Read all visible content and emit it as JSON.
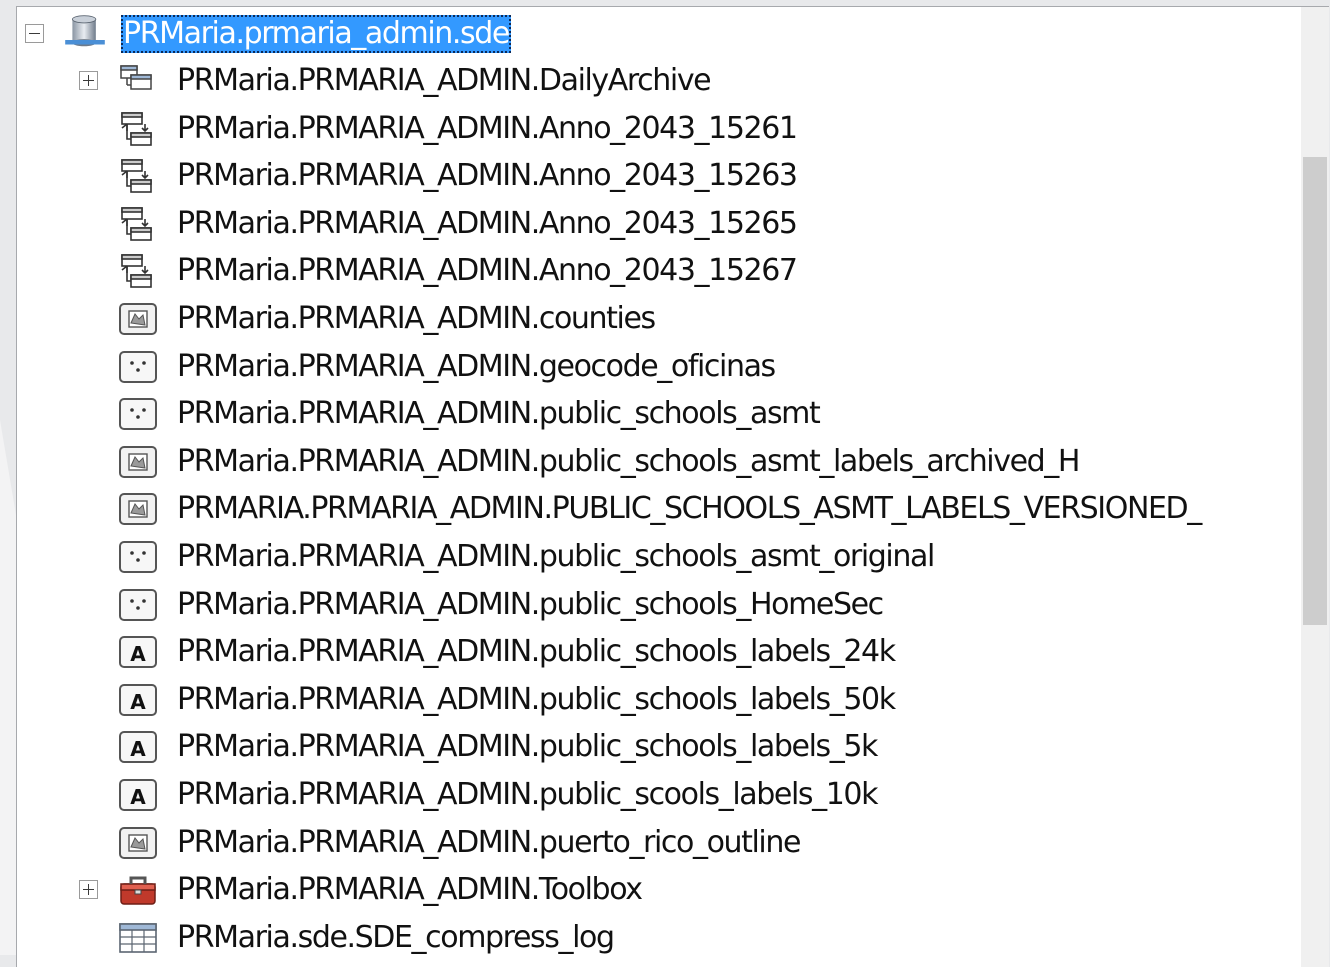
{
  "colors": {
    "selection": "#3399ff",
    "background": "#ffffff",
    "text": "#111111"
  },
  "tree": {
    "root": {
      "label": "PRMaria.prmaria_admin.sde",
      "icon": "database-connection-icon",
      "expanded": true,
      "selected": true
    },
    "items": [
      {
        "label": "PRMaria.PRMARIA_ADMIN.DailyArchive",
        "icon": "feature-dataset-icon",
        "expandable": true
      },
      {
        "label": "PRMaria.PRMARIA_ADMIN.Anno_2043_15261",
        "icon": "relationship-class-icon",
        "expandable": false
      },
      {
        "label": "PRMaria.PRMARIA_ADMIN.Anno_2043_15263",
        "icon": "relationship-class-icon",
        "expandable": false
      },
      {
        "label": "PRMaria.PRMARIA_ADMIN.Anno_2043_15265",
        "icon": "relationship-class-icon",
        "expandable": false
      },
      {
        "label": "PRMaria.PRMARIA_ADMIN.Anno_2043_15267",
        "icon": "relationship-class-icon",
        "expandable": false
      },
      {
        "label": "PRMaria.PRMARIA_ADMIN.counties",
        "icon": "polygon-feature-class-icon",
        "expandable": false
      },
      {
        "label": "PRMaria.PRMARIA_ADMIN.geocode_oficinas",
        "icon": "point-feature-class-icon",
        "expandable": false
      },
      {
        "label": "PRMaria.PRMARIA_ADMIN.public_schools_asmt",
        "icon": "point-feature-class-icon",
        "expandable": false
      },
      {
        "label": "PRMaria.PRMARIA_ADMIN.public_schools_asmt_labels_archived_H",
        "icon": "polygon-feature-class-icon",
        "expandable": false
      },
      {
        "label": "PRMARIA.PRMARIA_ADMIN.PUBLIC_SCHOOLS_ASMT_LABELS_VERSIONED_",
        "icon": "polygon-feature-class-icon",
        "expandable": false
      },
      {
        "label": "PRMaria.PRMARIA_ADMIN.public_schools_asmt_original",
        "icon": "point-feature-class-icon",
        "expandable": false
      },
      {
        "label": "PRMaria.PRMARIA_ADMIN.public_schools_HomeSec",
        "icon": "point-feature-class-icon",
        "expandable": false
      },
      {
        "label": "PRMaria.PRMARIA_ADMIN.public_schools_labels_24k",
        "icon": "annotation-feature-class-icon",
        "expandable": false
      },
      {
        "label": "PRMaria.PRMARIA_ADMIN.public_schools_labels_50k",
        "icon": "annotation-feature-class-icon",
        "expandable": false
      },
      {
        "label": "PRMaria.PRMARIA_ADMIN.public_schools_labels_5k",
        "icon": "annotation-feature-class-icon",
        "expandable": false
      },
      {
        "label": "PRMaria.PRMARIA_ADMIN.public_scools_labels_10k",
        "icon": "annotation-feature-class-icon",
        "expandable": false
      },
      {
        "label": "PRMaria.PRMARIA_ADMIN.puerto_rico_outline",
        "icon": "polygon-feature-class-icon",
        "expandable": false
      },
      {
        "label": "PRMaria.PRMARIA_ADMIN.Toolbox",
        "icon": "toolbox-icon",
        "expandable": true
      },
      {
        "label": "PRMaria.sde.SDE_compress_log",
        "icon": "table-icon",
        "expandable": false
      }
    ]
  }
}
